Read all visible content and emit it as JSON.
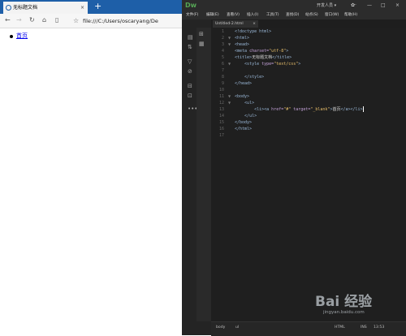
{
  "browser": {
    "tab_title": "无标题文档",
    "tab_close": "×",
    "new_tab": "+",
    "address": "file:///C:/Users/oscaryang/De",
    "nav": {
      "back": "←",
      "forward": "→",
      "reload": "↻",
      "home": "⌂",
      "reading": "▯",
      "fav": "☆"
    },
    "link_text": "首页"
  },
  "dreamweaver": {
    "logo": "Dw",
    "workspace": "开发人员 ▾",
    "gear": "✿·",
    "window_controls": {
      "minimize": "—",
      "maximize": "□",
      "close": "×"
    },
    "menu": [
      "文件(F)",
      "编辑(E)",
      "查看(V)",
      "插入(I)",
      "工具(T)",
      "查找(D)",
      "站点(S)",
      "窗口(W)",
      "帮助(H)"
    ],
    "file_tab": "Untitled-2.html",
    "file_tab_close": "×",
    "toolbar_icons": [
      "file-icon",
      "arrows-icon",
      "funnel-icon",
      "link-icon",
      "split-icon",
      "preview-icon",
      "more-icon"
    ],
    "code_lines": [
      {
        "n": "1",
        "fold": "",
        "parts": [
          [
            "tag",
            "<!doctype html>"
          ]
        ]
      },
      {
        "n": "2",
        "fold": "▼",
        "parts": [
          [
            "tag",
            "<html>"
          ]
        ]
      },
      {
        "n": "3",
        "fold": "▼",
        "parts": [
          [
            "tag",
            "<head>"
          ]
        ]
      },
      {
        "n": "4",
        "fold": "",
        "parts": [
          [
            "tag",
            "<meta "
          ],
          [
            "attr",
            "charset="
          ],
          [
            "str",
            "\"utf-8\""
          ],
          [
            "tag",
            ">"
          ]
        ]
      },
      {
        "n": "5",
        "fold": "",
        "parts": [
          [
            "tag",
            "<title>"
          ],
          [
            "txt",
            "无标题文档"
          ],
          [
            "tag",
            "</title>"
          ]
        ]
      },
      {
        "n": "6",
        "fold": "▼",
        "parts": [
          [
            "txt",
            "    "
          ],
          [
            "tag",
            "<style "
          ],
          [
            "attr",
            "type="
          ],
          [
            "str",
            "\"text/css\""
          ],
          [
            "tag",
            ">"
          ]
        ]
      },
      {
        "n": "7",
        "fold": "",
        "parts": [
          [
            "txt",
            ""
          ]
        ]
      },
      {
        "n": "8",
        "fold": "",
        "parts": [
          [
            "txt",
            "    "
          ],
          [
            "tag",
            "</style>"
          ]
        ]
      },
      {
        "n": "9",
        "fold": "",
        "parts": [
          [
            "tag",
            "</head>"
          ]
        ]
      },
      {
        "n": "10",
        "fold": "",
        "parts": [
          [
            "txt",
            ""
          ]
        ]
      },
      {
        "n": "11",
        "fold": "▼",
        "parts": [
          [
            "tag",
            "<body>"
          ]
        ]
      },
      {
        "n": "12",
        "fold": "▼",
        "parts": [
          [
            "txt",
            "    "
          ],
          [
            "tag",
            "<ul>"
          ]
        ]
      },
      {
        "n": "13",
        "fold": "",
        "parts": [
          [
            "txt",
            "        "
          ],
          [
            "tag",
            "<li><a "
          ],
          [
            "attr",
            "href="
          ],
          [
            "str",
            "\"#\""
          ],
          [
            "attr",
            " target="
          ],
          [
            "str",
            "\"_blank\""
          ],
          [
            "tag",
            ">"
          ],
          [
            "txt",
            "首页"
          ],
          [
            "tag",
            "</a></li>"
          ]
        ]
      },
      {
        "n": "14",
        "fold": "",
        "parts": [
          [
            "txt",
            "    "
          ],
          [
            "tag",
            "</ul>"
          ]
        ]
      },
      {
        "n": "15",
        "fold": "",
        "parts": [
          [
            "tag",
            "</body>"
          ]
        ]
      },
      {
        "n": "16",
        "fold": "",
        "parts": [
          [
            "tag",
            "</html>"
          ]
        ]
      },
      {
        "n": "17",
        "fold": "",
        "parts": [
          [
            "txt",
            ""
          ]
        ]
      }
    ],
    "status": {
      "body_tag": "body",
      "li_tag": "ul",
      "mode": "HTML",
      "size": "INS",
      "pos": "13:53"
    }
  },
  "watermark": {
    "brand": "Bai 经验",
    "sub": "jingyan.baidu.com"
  }
}
